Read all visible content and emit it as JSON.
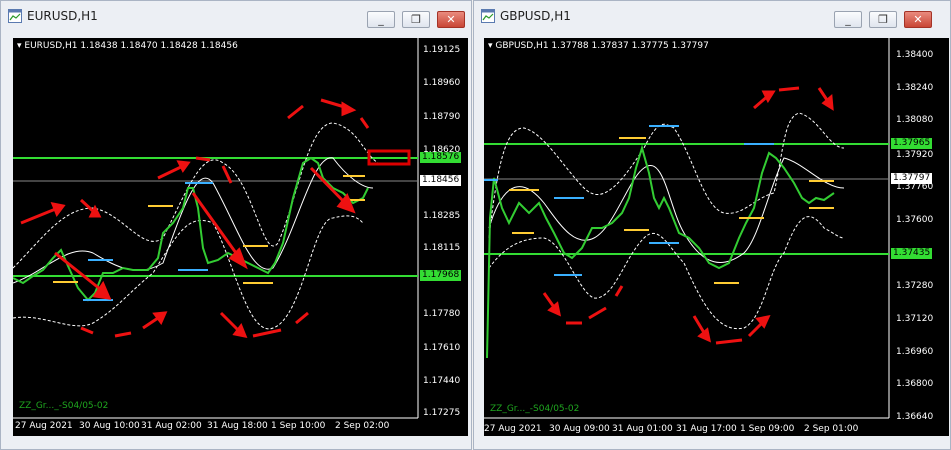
{
  "windows": [
    {
      "title": "EURUSD,H1",
      "info": "EURUSD,H1  1.18438 1.18470 1.18428 1.18456",
      "indicator": "ZZ_Gr..._-S04/05-02",
      "current_price": "1.18456",
      "upper_level": "1.18576",
      "lower_level": "1.17968",
      "y_labels": [
        "1.19125",
        "1.18960",
        "1.18790",
        "1.18620",
        "1.18456",
        "1.18285",
        "1.18115",
        "1.17945",
        "1.17780",
        "1.17610",
        "1.17440",
        "1.17275"
      ],
      "x_labels": [
        "27 Aug 2021",
        "30 Aug 10:00",
        "31 Aug 02:00",
        "31 Aug 18:00",
        "1 Sep 10:00",
        "2 Sep 02:00"
      ]
    },
    {
      "title": "GBPUSD,H1",
      "info": "GBPUSD,H1  1.37788 1.37837 1.37775 1.37797",
      "indicator": "ZZ_Gr..._-S04/05-02",
      "current_price": "1.37797",
      "upper_level": "1.37965",
      "lower_level": "1.37435",
      "y_labels": [
        "1.38400",
        "1.38240",
        "1.38080",
        "1.37920",
        "1.37760",
        "1.37600",
        "1.37440",
        "1.37280",
        "1.37120",
        "1.36960",
        "1.36800",
        "1.36640"
      ],
      "x_labels": [
        "27 Aug 2021",
        "30 Aug 09:00",
        "31 Aug 01:00",
        "31 Aug 17:00",
        "1 Sep 09:00",
        "2 Sep 01:00"
      ]
    }
  ],
  "colors": {
    "background": "#000000",
    "level_line": "#33dd33",
    "arrow": "#ee1111",
    "candle": "#33cc33",
    "band": "#ffffff",
    "highlight": "#dd0000"
  },
  "icons": [
    "chart-window-icon",
    "minimize-icon",
    "restore-icon",
    "close-icon"
  ],
  "buttons": {
    "minimize": "_",
    "restore": "❐",
    "close": "✕"
  }
}
